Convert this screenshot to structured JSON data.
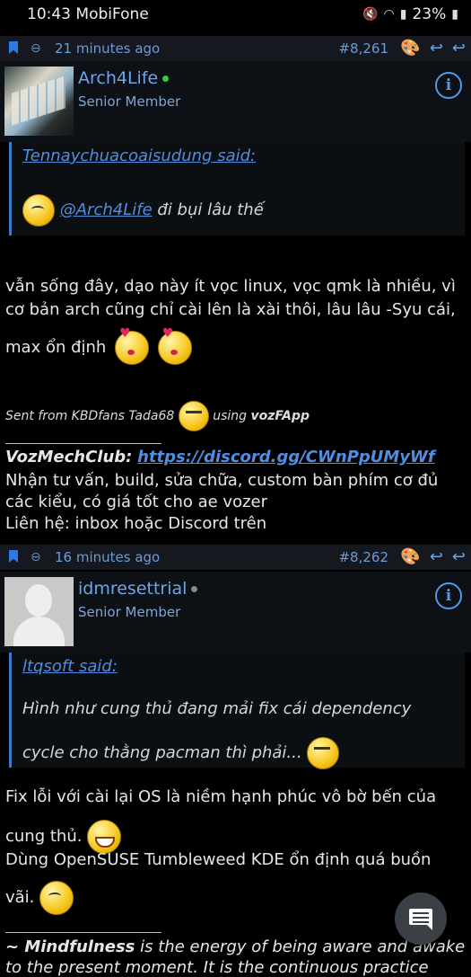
{
  "status_bar": {
    "time": "10:43 MobiFone",
    "battery": "23%"
  },
  "posts": [
    {
      "time": "21 minutes ago",
      "number": "#8,261",
      "author": "Arch4Life",
      "role": "Senior Member",
      "online_color": "#2ecc40",
      "quote_author": "Tennaychuacoaisudung said:",
      "quote_mention": "@Arch4Life",
      "quote_text": " đi bụi lâu thế",
      "body_line1": "vẫn sống đây, dạo này ít vọc linux, vọc qmk là nhiều, vì",
      "body_line2": "cơ bản arch cũng chỉ cài lên là xài thôi, lâu lâu -Syu cái,",
      "body_line3": "max ổn định",
      "sig_prefix": "Sent from KBDfans Tada68",
      "sig_using": "using",
      "sig_app": "vozFApp",
      "club_label": "VozMechClub:",
      "club_link": "https://discord.gg/CWnPpUMyWf",
      "club_line1": "Nhận tư vấn, build, sửa chữa, custom bàn phím cơ đủ",
      "club_line2": "các kiểu, có giá tốt cho ae vozer",
      "club_line3": "Liên hệ: inbox hoặc Discord trên"
    },
    {
      "time": "16 minutes ago",
      "number": "#8,262",
      "author": "idmresettrial",
      "role": "Senior Member",
      "online_color": "#888888",
      "quote_author": "ltqsoft said:",
      "quote_line1": "Hình như cung thủ đang mải fix cái dependency",
      "quote_line2": "cycle cho thằng pacman thì phải...",
      "body_line1": "Fix lỗi với cài lại OS là niềm hạnh phúc vô bờ bến của",
      "body_line2": "cung thủ.",
      "body_line3": "Dùng OpenSUSE Tumbleweed KDE ổn định quá buồn",
      "body_line4": "vãi.",
      "sig_bold": "~ Mindfulness",
      "sig_text": " is the energy of being aware and awake",
      "sig_line2": "to the present moment. It is the continuous practice"
    }
  ],
  "colors": {
    "accent": "#4f8ee0",
    "header_bg": "#15191f",
    "user_bg": "#0d1014"
  }
}
